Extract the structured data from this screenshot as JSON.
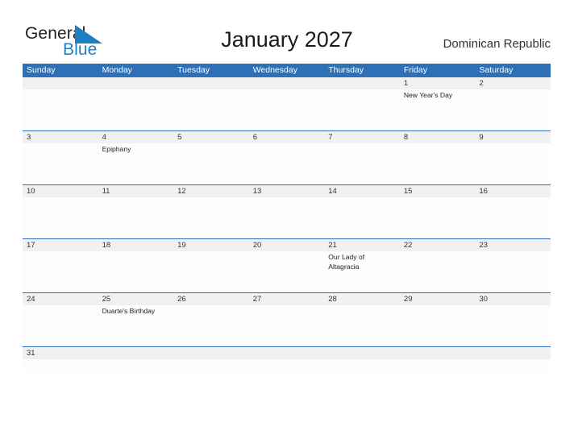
{
  "brand": {
    "name_part1": "General",
    "name_part2": "Blue",
    "flag_icon": "flag-triangle-icon",
    "accent_color": "#1f7fc4",
    "dark_color": "#231f20"
  },
  "header": {
    "title": "January 2027",
    "region": "Dominican Republic"
  },
  "calendar": {
    "header_bg": "#2e70b5",
    "date_band_bg": "#f1f1f1",
    "grid_line_color": "#2e70b5",
    "month": "January",
    "year": "2027",
    "weekday_headers": [
      "Sunday",
      "Monday",
      "Tuesday",
      "Wednesday",
      "Thursday",
      "Friday",
      "Saturday"
    ],
    "weeks": [
      {
        "dates": [
          "",
          "",
          "",
          "",
          "",
          "1",
          "2"
        ],
        "events": [
          "",
          "",
          "",
          "",
          "",
          "New Year's Day",
          ""
        ]
      },
      {
        "dates": [
          "3",
          "4",
          "5",
          "6",
          "7",
          "8",
          "9"
        ],
        "events": [
          "",
          "Epiphany",
          "",
          "",
          "",
          "",
          ""
        ]
      },
      {
        "dates": [
          "10",
          "11",
          "12",
          "13",
          "14",
          "15",
          "16"
        ],
        "events": [
          "",
          "",
          "",
          "",
          "",
          "",
          ""
        ]
      },
      {
        "dates": [
          "17",
          "18",
          "19",
          "20",
          "21",
          "22",
          "23"
        ],
        "events": [
          "",
          "",
          "",
          "",
          "Our Lady of Altagracia",
          "",
          ""
        ]
      },
      {
        "dates": [
          "24",
          "25",
          "26",
          "27",
          "28",
          "29",
          "30"
        ],
        "events": [
          "",
          "Duarte's Birthday",
          "",
          "",
          "",
          "",
          ""
        ]
      },
      {
        "dates": [
          "31",
          "",
          "",
          "",
          "",
          "",
          ""
        ],
        "events": [
          "",
          "",
          "",
          "",
          "",
          "",
          ""
        ]
      }
    ]
  }
}
